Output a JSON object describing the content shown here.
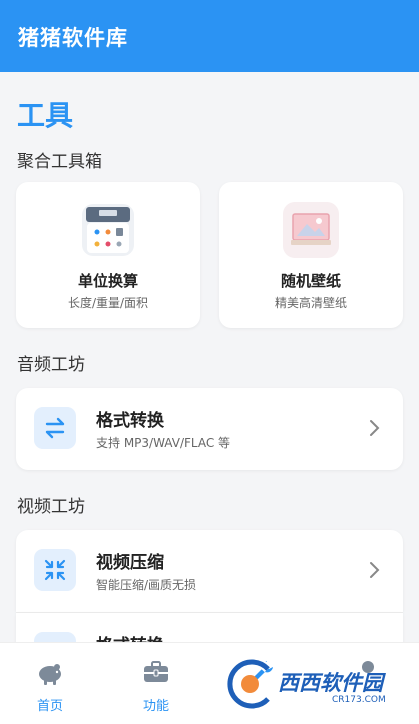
{
  "app": {
    "title": "猪猪软件库"
  },
  "page": {
    "title": "工具"
  },
  "sections": {
    "toolbox": {
      "title": "聚合工具箱",
      "items": [
        {
          "name": "单位换算",
          "desc": "长度/重量/面积",
          "icon": "calculator-icon"
        },
        {
          "name": "随机壁纸",
          "desc": "精美高清壁纸",
          "icon": "wallpaper-icon"
        }
      ]
    },
    "audio": {
      "title": "音频工坊",
      "items": [
        {
          "name": "格式转换",
          "desc": "支持 MP3/WAV/FLAC 等",
          "icon": "swap-arrows-icon"
        }
      ]
    },
    "video": {
      "title": "视频工坊",
      "items": [
        {
          "name": "视频压缩",
          "desc": "智能压缩/画质无损",
          "icon": "compress-icon"
        },
        {
          "name": "格式转换",
          "desc": "",
          "icon": "convert-icon"
        }
      ]
    }
  },
  "nav": {
    "items": [
      {
        "label": "首页",
        "icon": "piggy-bank-icon"
      },
      {
        "label": "功能",
        "icon": "toolbox-icon"
      },
      {
        "label": "",
        "icon": "wrench-icon"
      },
      {
        "label": "",
        "icon": "user-icon"
      }
    ]
  },
  "watermark": {
    "text": "西西软件园",
    "url": "CR173.COM"
  },
  "colors": {
    "accent": "#2b93f3",
    "background": "#f4f5f7",
    "card": "#ffffff",
    "icon_bg": "#e3effd"
  }
}
